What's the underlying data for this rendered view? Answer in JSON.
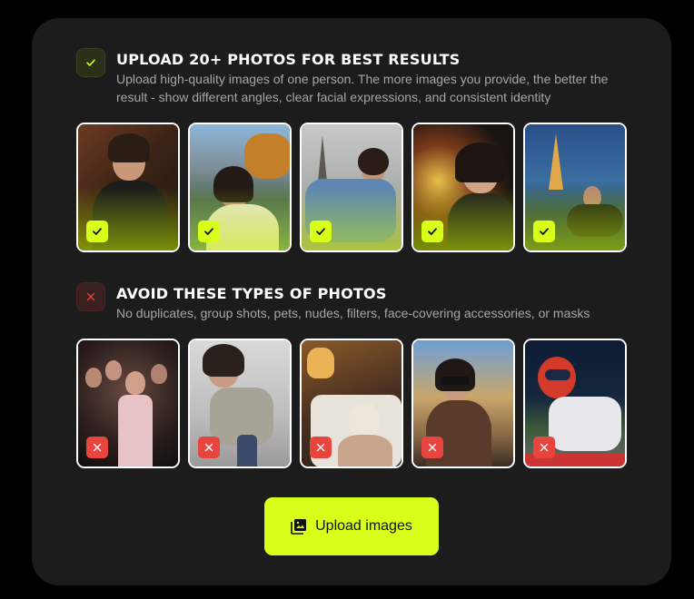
{
  "good_section": {
    "title": "UPLOAD 20+ PHOTOS FOR BEST RESULTS",
    "description": "Upload high-quality images of one person. The more images you provide, the better the result - show different angles, clear facial expressions, and consistent identity",
    "badge_icon": "check-icon",
    "accent": "#d7ff1a",
    "photos": [
      {
        "alt": "selfie-with-noodles",
        "mark_icon": "check-icon"
      },
      {
        "alt": "lakeside-mountains-portrait",
        "mark_icon": "check-icon"
      },
      {
        "alt": "eiffel-tower-sitting",
        "mark_icon": "check-icon"
      },
      {
        "alt": "night-market-selfie",
        "mark_icon": "check-icon"
      },
      {
        "alt": "eiffel-tower-night-fountain",
        "mark_icon": "check-icon"
      }
    ]
  },
  "bad_section": {
    "title": "AVOID THESE TYPES OF PHOTOS",
    "description": "No duplicates, group shots, pets, nudes, filters, face-covering accessories, or masks",
    "badge_icon": "close-icon",
    "accent": "#e8453f",
    "photos": [
      {
        "alt": "group-shot-party",
        "mark_icon": "close-icon"
      },
      {
        "alt": "blurry-motion-shot",
        "mark_icon": "close-icon"
      },
      {
        "alt": "face-mask-selfie",
        "mark_icon": "close-icon"
      },
      {
        "alt": "sunglasses-cafe",
        "mark_icon": "close-icon"
      },
      {
        "alt": "racing-helmet",
        "mark_icon": "close-icon"
      }
    ]
  },
  "upload_button": {
    "label": "Upload images",
    "icon": "image-gallery-icon"
  }
}
